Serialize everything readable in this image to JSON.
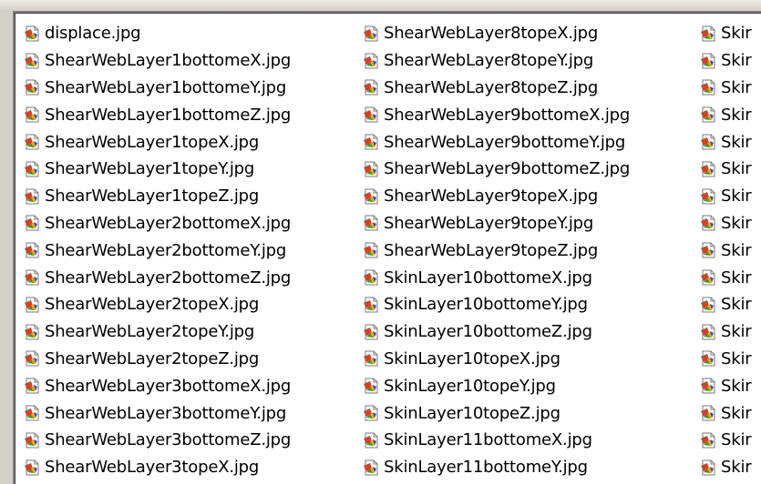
{
  "file_list": {
    "item_icon": "jpeg-image-file-icon",
    "columns": [
      {
        "items": [
          "displace.jpg",
          "ShearWebLayer1bottomeX.jpg",
          "ShearWebLayer1bottomeY.jpg",
          "ShearWebLayer1bottomeZ.jpg",
          "ShearWebLayer1topeX.jpg",
          "ShearWebLayer1topeY.jpg",
          "ShearWebLayer1topeZ.jpg",
          "ShearWebLayer2bottomeX.jpg",
          "ShearWebLayer2bottomeY.jpg",
          "ShearWebLayer2bottomeZ.jpg",
          "ShearWebLayer2topeX.jpg",
          "ShearWebLayer2topeY.jpg",
          "ShearWebLayer2topeZ.jpg",
          "ShearWebLayer3bottomeX.jpg",
          "ShearWebLayer3bottomeY.jpg",
          "ShearWebLayer3bottomeZ.jpg",
          "ShearWebLayer3topeX.jpg"
        ]
      },
      {
        "items": [
          "ShearWebLayer8topeX.jpg",
          "ShearWebLayer8topeY.jpg",
          "ShearWebLayer8topeZ.jpg",
          "ShearWebLayer9bottomeX.jpg",
          "ShearWebLayer9bottomeY.jpg",
          "ShearWebLayer9bottomeZ.jpg",
          "ShearWebLayer9topeX.jpg",
          "ShearWebLayer9topeY.jpg",
          "ShearWebLayer9topeZ.jpg",
          "SkinLayer10bottomeX.jpg",
          "SkinLayer10bottomeY.jpg",
          "SkinLayer10bottomeZ.jpg",
          "SkinLayer10topeX.jpg",
          "SkinLayer10topeY.jpg",
          "SkinLayer10topeZ.jpg",
          "SkinLayer11bottomeX.jpg",
          "SkinLayer11bottomeY.jpg"
        ]
      },
      {
        "items": [
          "Skir",
          "Skir",
          "Skir",
          "Skir",
          "Skir",
          "Skir",
          "Skir",
          "Skir",
          "Skir",
          "Skir",
          "Skir",
          "Skir",
          "Skir",
          "Skir",
          "Skir",
          "Skir",
          "Skir"
        ]
      }
    ]
  },
  "colors": {
    "icon_page": "#ffffff",
    "icon_border": "#7a7a7a",
    "icon_accent_red": "#d0441f",
    "icon_accent_orange": "#f0a030",
    "icon_accent_green": "#3a9a2a",
    "icon_accent_blue": "#2050c0"
  }
}
